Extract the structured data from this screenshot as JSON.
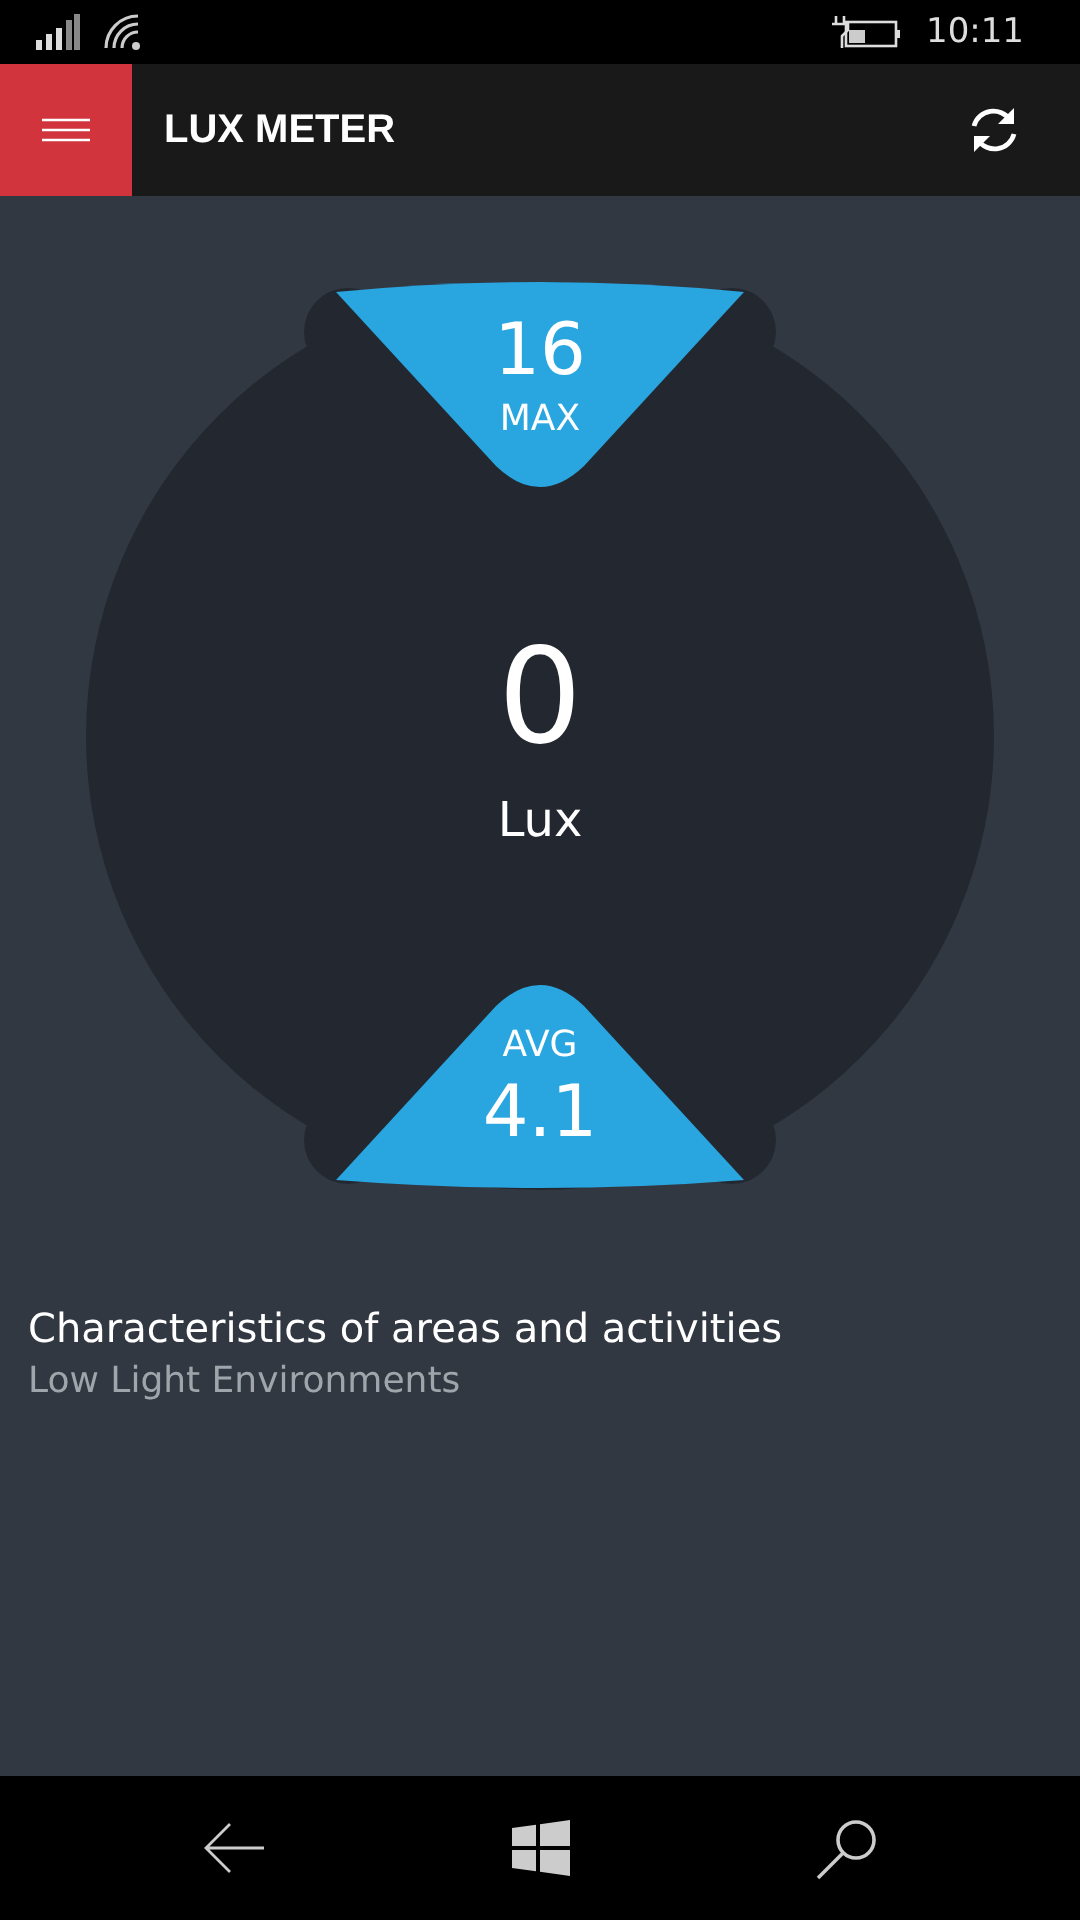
{
  "status_bar": {
    "time": "10:11"
  },
  "header": {
    "title": "LUX METER"
  },
  "gauge": {
    "max": {
      "value": "16",
      "label": "MAX"
    },
    "reading": {
      "value": "0",
      "unit": "Lux"
    },
    "avg": {
      "label": "AVG",
      "value": "4.1"
    }
  },
  "info": {
    "title": "Characteristics of areas and activities",
    "subtitle": "Low Light Environments"
  }
}
